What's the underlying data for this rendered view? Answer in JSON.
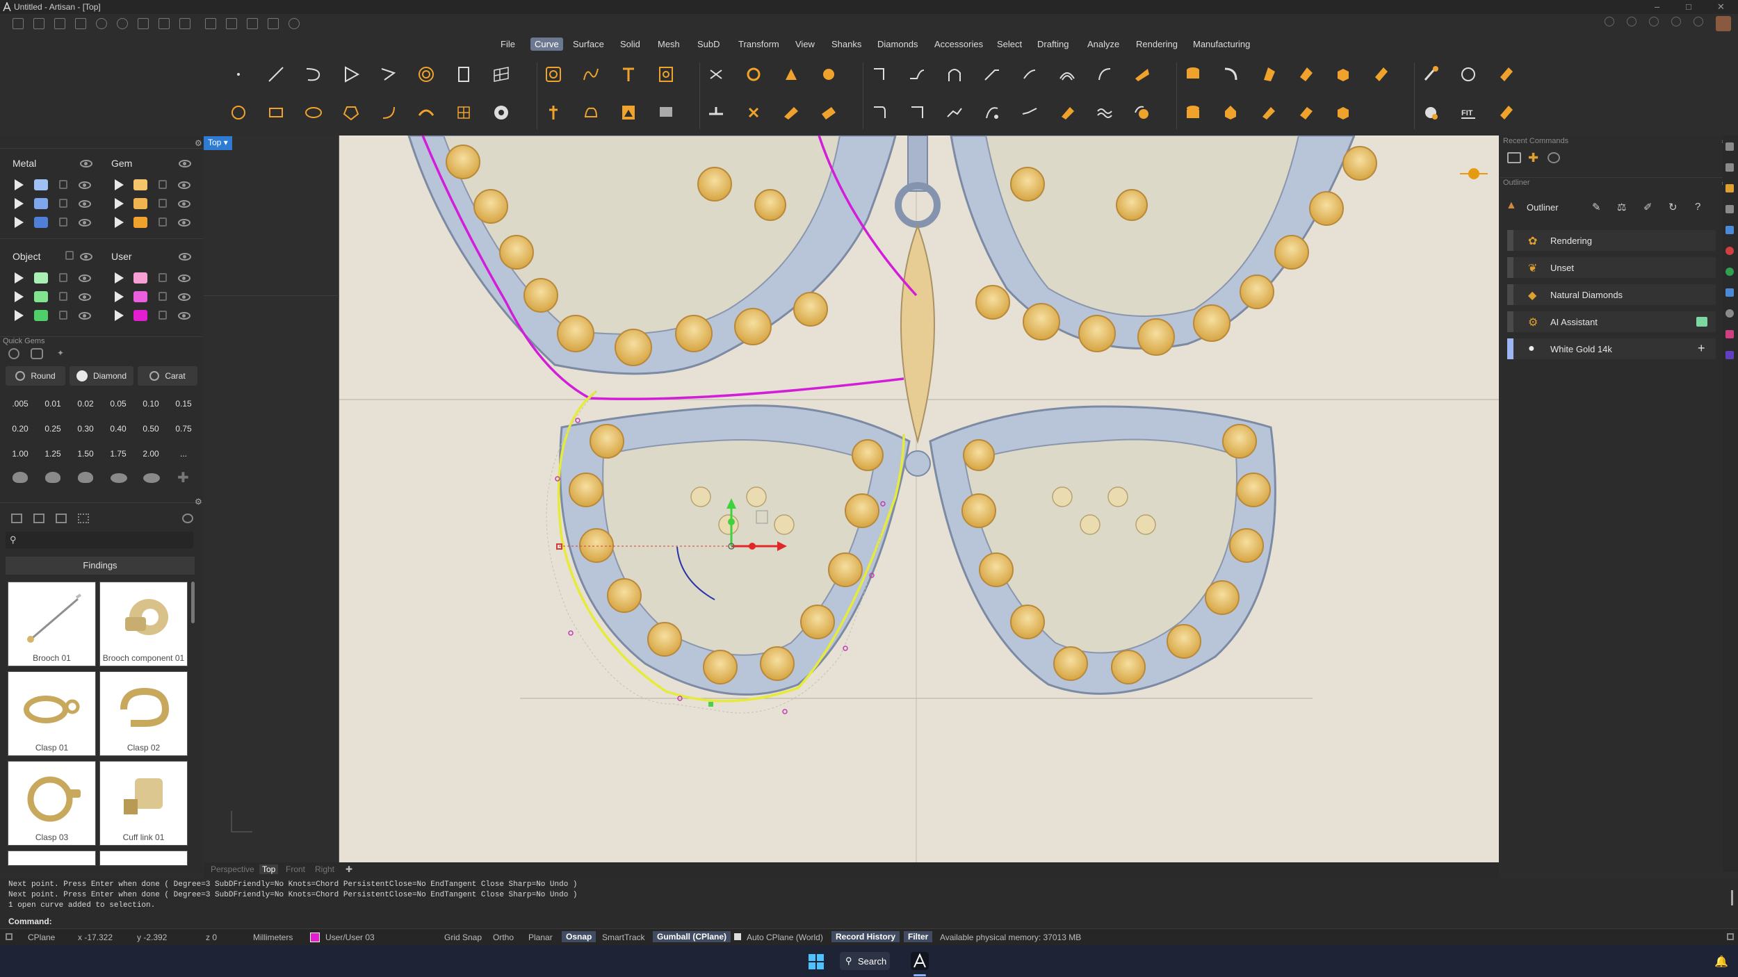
{
  "window": {
    "title": "Untitled - Artisan - [Top]"
  },
  "menu": {
    "items": [
      "File",
      "Curve",
      "Surface",
      "Solid",
      "Mesh",
      "SubD",
      "Transform",
      "View",
      "Shanks",
      "Diamonds",
      "Accessories",
      "Select",
      "Drafting",
      "Analyze",
      "Rendering",
      "Manufacturing"
    ],
    "active": "Curve"
  },
  "layers": {
    "metal": {
      "label": "Metal",
      "swatches": [
        "#9fc0f5",
        "#7ea7ee",
        "#4f7fd6"
      ]
    },
    "gem": {
      "label": "Gem",
      "swatches": [
        "#f4c56a",
        "#f1b44f",
        "#f0a32c"
      ]
    },
    "object": {
      "label": "Object",
      "swatches": [
        "#a9f0b5",
        "#7fe58f",
        "#4fcf6a"
      ]
    },
    "user": {
      "label": "User",
      "swatches": [
        "#f6a0d6",
        "#ec5ee0",
        "#e21ed0"
      ]
    }
  },
  "quick_gems": {
    "title": "Quick Gems",
    "shape": "Round",
    "material": "Diamond",
    "unit": "Carat",
    "sizes": [
      ".005",
      "0.01",
      "0.02",
      "0.05",
      "0.10",
      "0.15",
      "0.20",
      "0.25",
      "0.30",
      "0.40",
      "0.50",
      "0.75",
      "1.00",
      "1.25",
      "1.50",
      "1.75",
      "2.00",
      "..."
    ]
  },
  "library": {
    "category": "Findings",
    "items": [
      "Brooch 01",
      "Brooch component 01",
      "Clasp 01",
      "Clasp 02",
      "Clasp 03",
      "Cuff link 01"
    ]
  },
  "viewport": {
    "name": "Top",
    "tabs": [
      "Perspective",
      "Top",
      "Front",
      "Right"
    ],
    "active_tab": "Top"
  },
  "right": {
    "recent_commands": "Recent Commands",
    "outliner_section": "Outliner",
    "outliner_title": "Outliner",
    "items": [
      "Rendering",
      "Unset",
      "Natural Diamonds",
      "AI Assistant",
      "White Gold 14k"
    ]
  },
  "command": {
    "history": [
      "Next point. Press Enter when done ( Degree=3  SubDFriendly=No  Knots=Chord  PersistentClose=No  EndTangent  Close  Sharp=No  Undo )",
      "Next point. Press Enter when done ( Degree=3  SubDFriendly=No  Knots=Chord  PersistentClose=No  EndTangent  Close  Sharp=No  Undo )",
      "1 open curve added to selection."
    ],
    "prompt": "Command:"
  },
  "status": {
    "cplane": "CPlane",
    "x": "x -17.322",
    "y": "y -2.392",
    "z": "z 0",
    "units": "Millimeters",
    "layer": "User/User 03",
    "grid_snap": "Grid Snap",
    "ortho": "Ortho",
    "planar": "Planar",
    "osnap": "Osnap",
    "smarttrack": "SmartTrack",
    "gumball": "Gumball (CPlane)",
    "auto_cplane": "Auto CPlane (World)",
    "record_history": "Record History",
    "filter": "Filter",
    "memory": "Available physical memory: 37013 MB"
  },
  "taskbar": {
    "search": "Search"
  },
  "colors": {
    "accent": "#2d7bd3",
    "curve_selected": "#e6ea3c",
    "curve_magenta": "#d21ed8"
  }
}
